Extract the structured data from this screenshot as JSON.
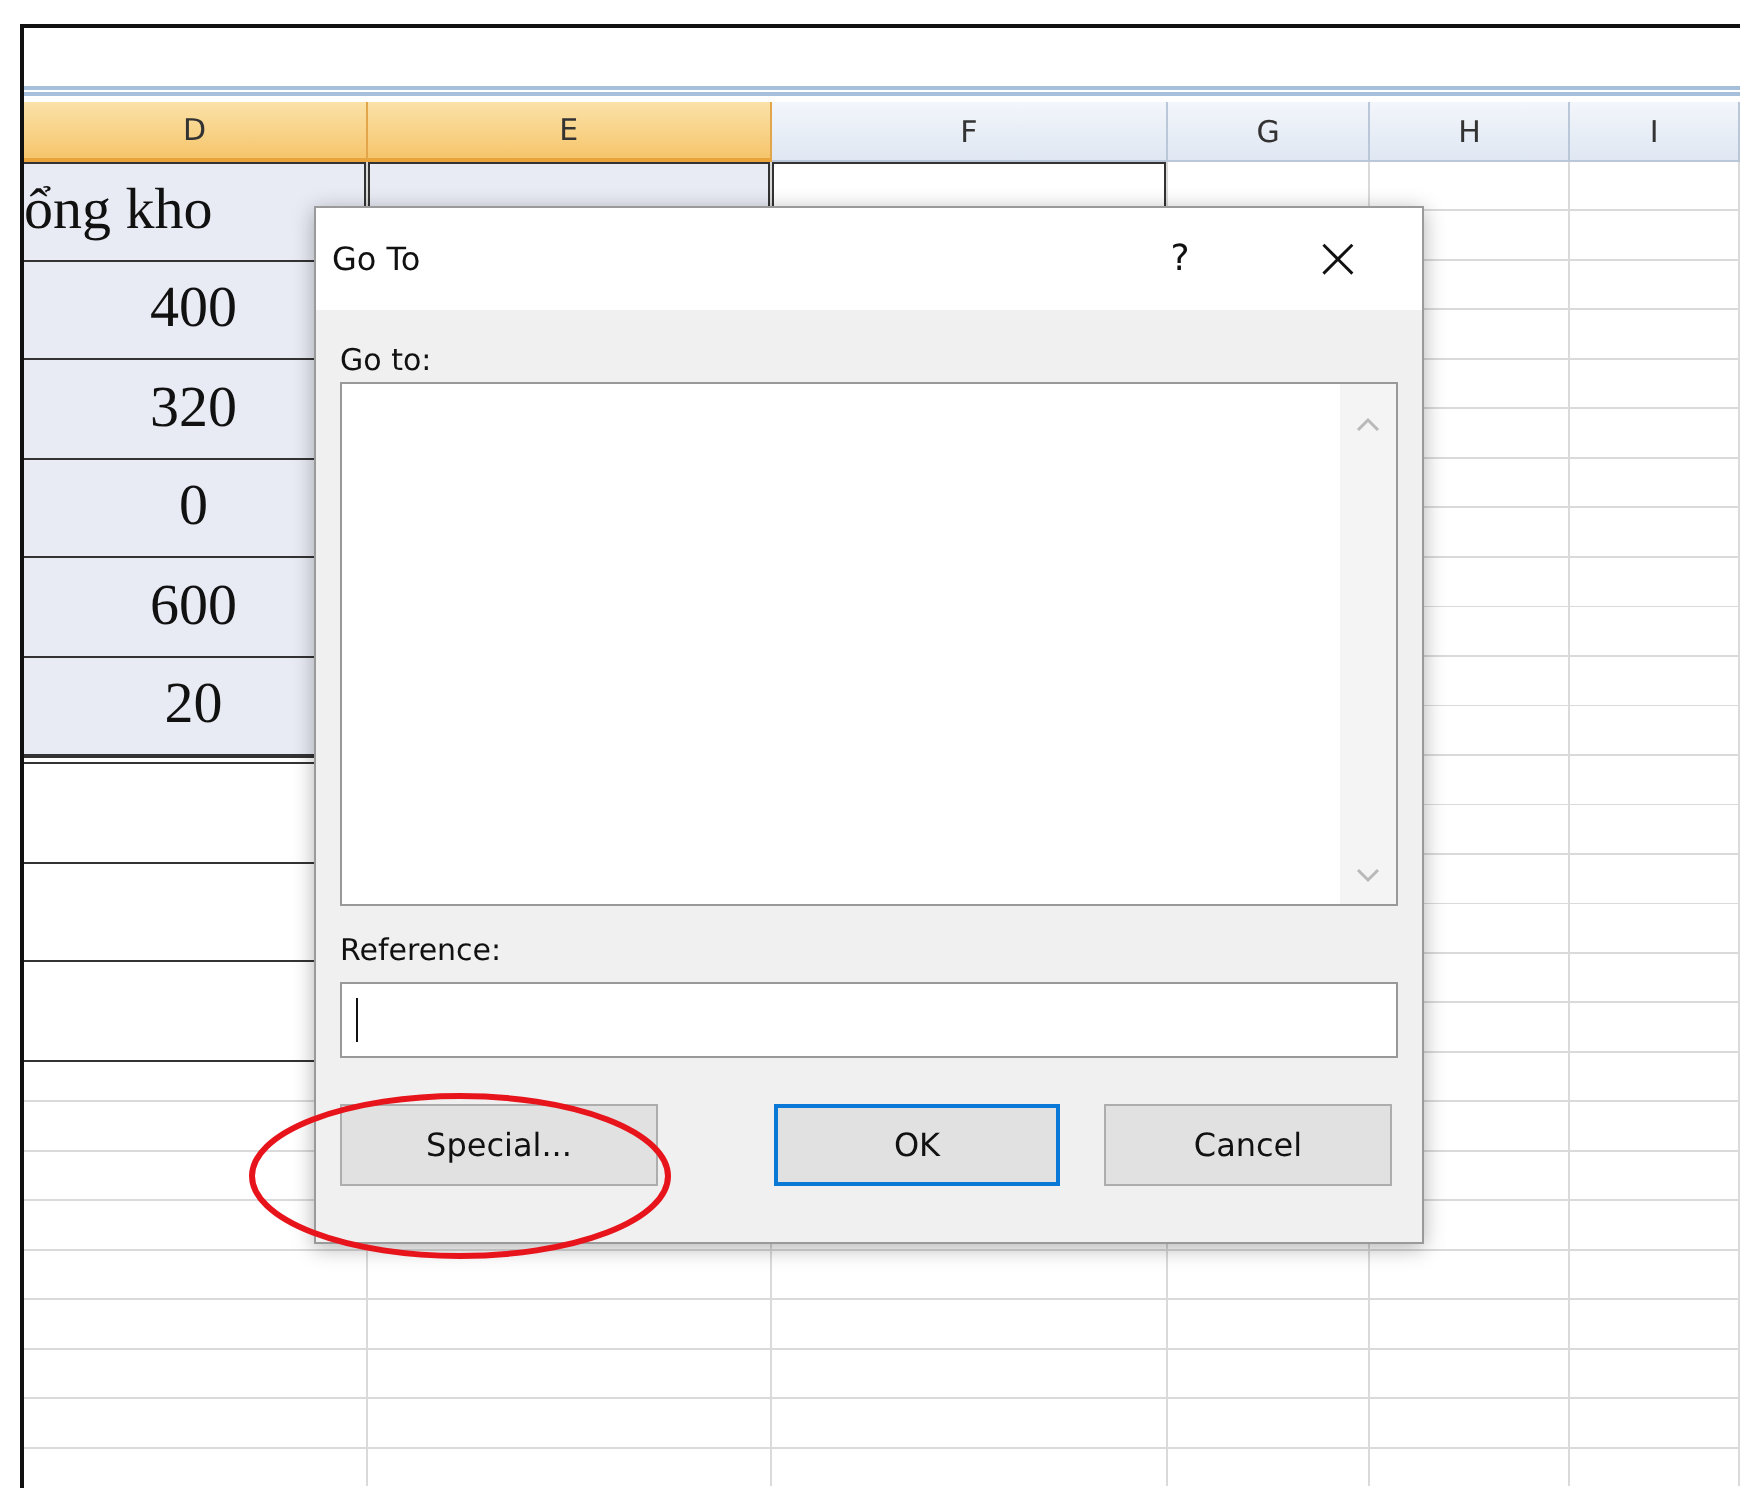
{
  "sheet": {
    "columns": [
      {
        "label": "D",
        "selected": true
      },
      {
        "label": "E",
        "selected": true
      },
      {
        "label": "F",
        "selected": false
      },
      {
        "label": "G",
        "selected": false
      },
      {
        "label": "H",
        "selected": false
      },
      {
        "label": "I",
        "selected": false
      }
    ],
    "column_d_cells": [
      "ổng kho",
      "400",
      "320",
      "0",
      "600",
      "20"
    ]
  },
  "dialog": {
    "title": "Go To",
    "help": "?",
    "close": "×",
    "list_label": "Go to:",
    "reference_label": "Reference:",
    "buttons": [
      {
        "label": "Special...",
        "kind": "action",
        "default": false
      },
      {
        "label": "OK",
        "kind": "confirm",
        "default": true
      },
      {
        "label": "Cancel",
        "kind": "cancel",
        "default": false
      }
    ]
  },
  "annotation": {
    "kind": "ellipse"
  }
}
